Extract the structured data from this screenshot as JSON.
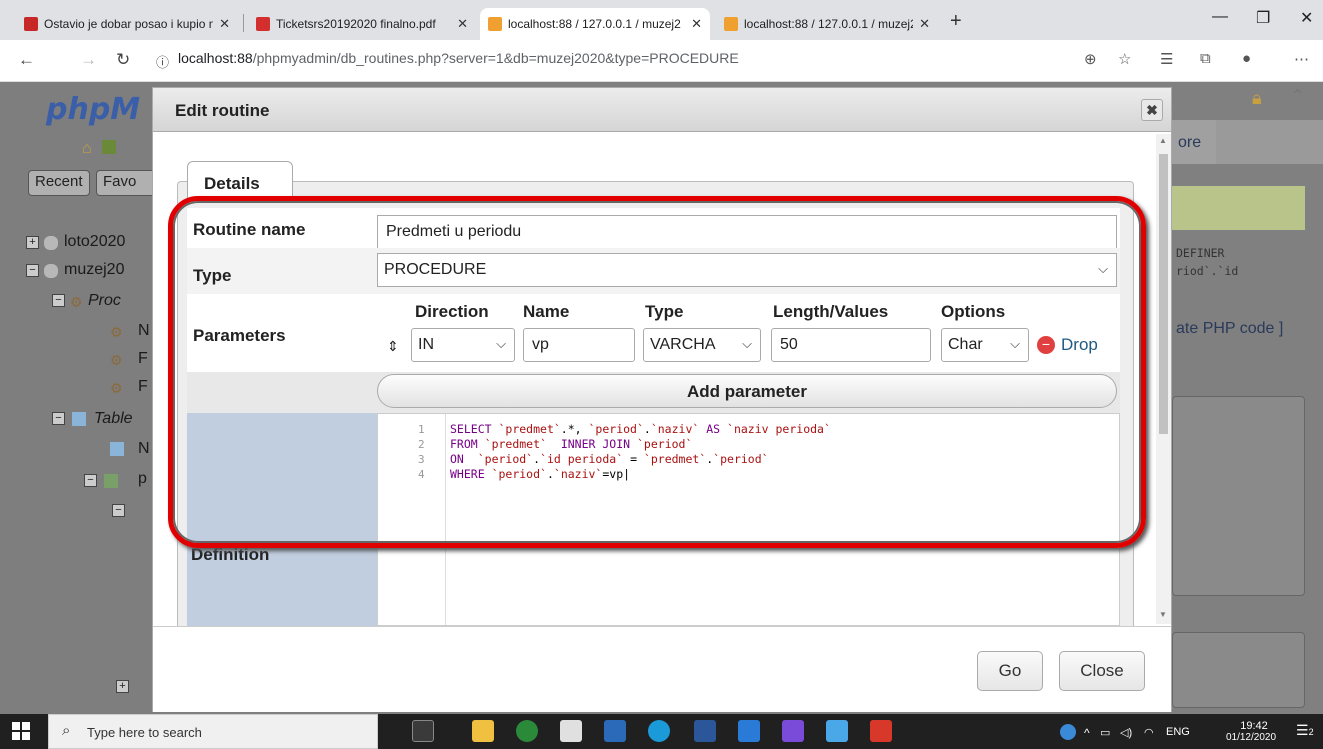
{
  "browser": {
    "tabs": [
      {
        "label": "Ostavio je dobar posao i kupio n",
        "active": false
      },
      {
        "label": "Ticketsrs20192020 finalno.pdf",
        "active": false
      },
      {
        "label": "localhost:88 / 127.0.0.1 / muzej2",
        "active": true
      },
      {
        "label": "localhost:88 / 127.0.0.1 / muzej2",
        "active": false
      }
    ],
    "url_host": "localhost:88",
    "url_path": "/phpmyadmin/db_routines.php?server=1&db=muzej2020&type=PROCEDURE"
  },
  "pma": {
    "logo": "phpM",
    "recent": "Recent",
    "favorites": "Favo",
    "tree": [
      "loto2020",
      "muzej20",
      "Proc",
      "N",
      "F",
      "F",
      "Table",
      "N",
      "p"
    ],
    "right_tab": "ore",
    "right_text1": "DEFINER",
    "right_text2": "riod`.`id",
    "right_link": "ate PHP code ]"
  },
  "dialog": {
    "title": "Edit routine",
    "close_symbol": "✖",
    "legend": "Details",
    "routine_name_label": "Routine name",
    "routine_name_value": "Predmeti u periodu",
    "type_label": "Type",
    "type_value": "PROCEDURE",
    "parameters_label": "Parameters",
    "param_headers": {
      "direction": "Direction",
      "name": "Name",
      "type": "Type",
      "length": "Length/Values",
      "options": "Options"
    },
    "param": {
      "direction": "IN",
      "name": "vp",
      "type": "VARCHA",
      "length": "50",
      "options": "Char"
    },
    "drop_label": "Drop",
    "add_parameter": "Add parameter",
    "definition_label": "Definition",
    "code_line_numbers": [
      "1",
      "2",
      "3",
      "4"
    ],
    "go": "Go",
    "close": "Close"
  },
  "taskbar": {
    "search_placeholder": "Type here to search",
    "lang": "ENG",
    "time": "19:42",
    "date": "01/12/2020",
    "notif": "2"
  }
}
